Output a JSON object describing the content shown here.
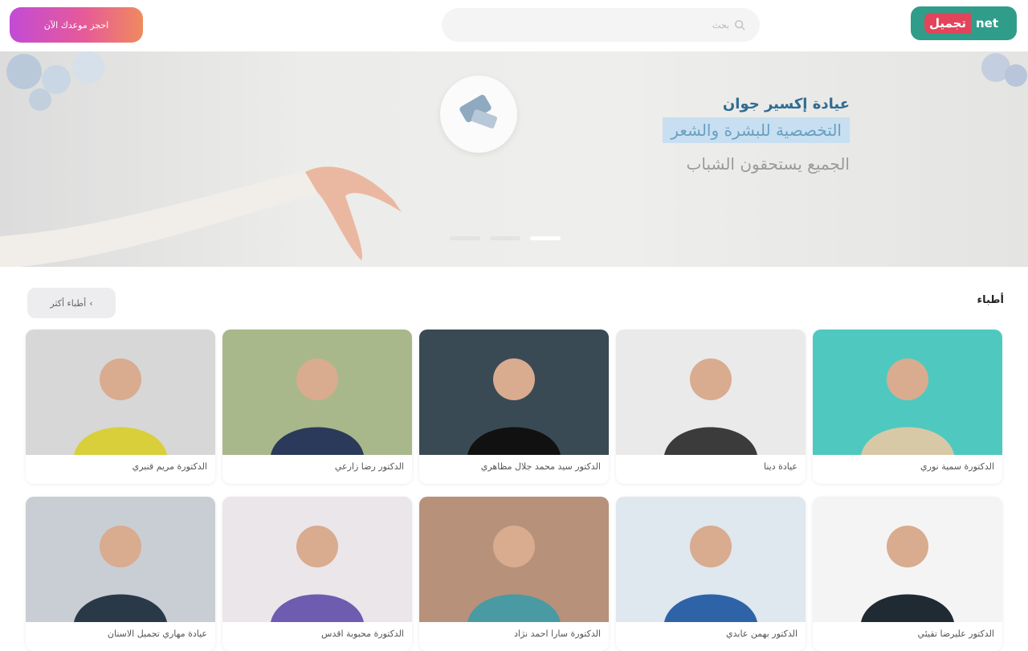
{
  "header": {
    "cta_label": "احجز موعدك الآن",
    "search_placeholder": "بحث",
    "logo_part1": "تجميل",
    "logo_part2": "net"
  },
  "hero": {
    "title": "عيادة إكسير جوان",
    "subtitle": "التخصصية للبشرة والشعر",
    "tagline": "الجميع يستحقون الشباب",
    "slides": [
      {
        "active": false
      },
      {
        "active": false
      },
      {
        "active": true
      }
    ]
  },
  "section": {
    "title": "أطباء",
    "more_label": "أطباء أكثر"
  },
  "doctors": [
    {
      "name": "الدكتورة سمية نوري"
    },
    {
      "name": "عيادة دينا"
    },
    {
      "name": "الدكتور سيد محمد جلال مظاهري"
    },
    {
      "name": "الدكتور رضا زارعي"
    },
    {
      "name": "الدكتورة مريم قنبري"
    },
    {
      "name": "الدكتور عليرضا تقيئي"
    },
    {
      "name": "الدكتور بهمن عابدي"
    },
    {
      "name": "الدكتورة سارا احمد نژاد"
    },
    {
      "name": "الدكتورة محبوبة اقدس"
    },
    {
      "name": "عيادة مهاري تجميل الاسنان"
    }
  ],
  "colors": {
    "accent_gradient_start": "#c24bd6",
    "accent_gradient_end": "#f08a5d",
    "logo_teal": "#2f9d8a",
    "logo_red": "#e2445b"
  }
}
